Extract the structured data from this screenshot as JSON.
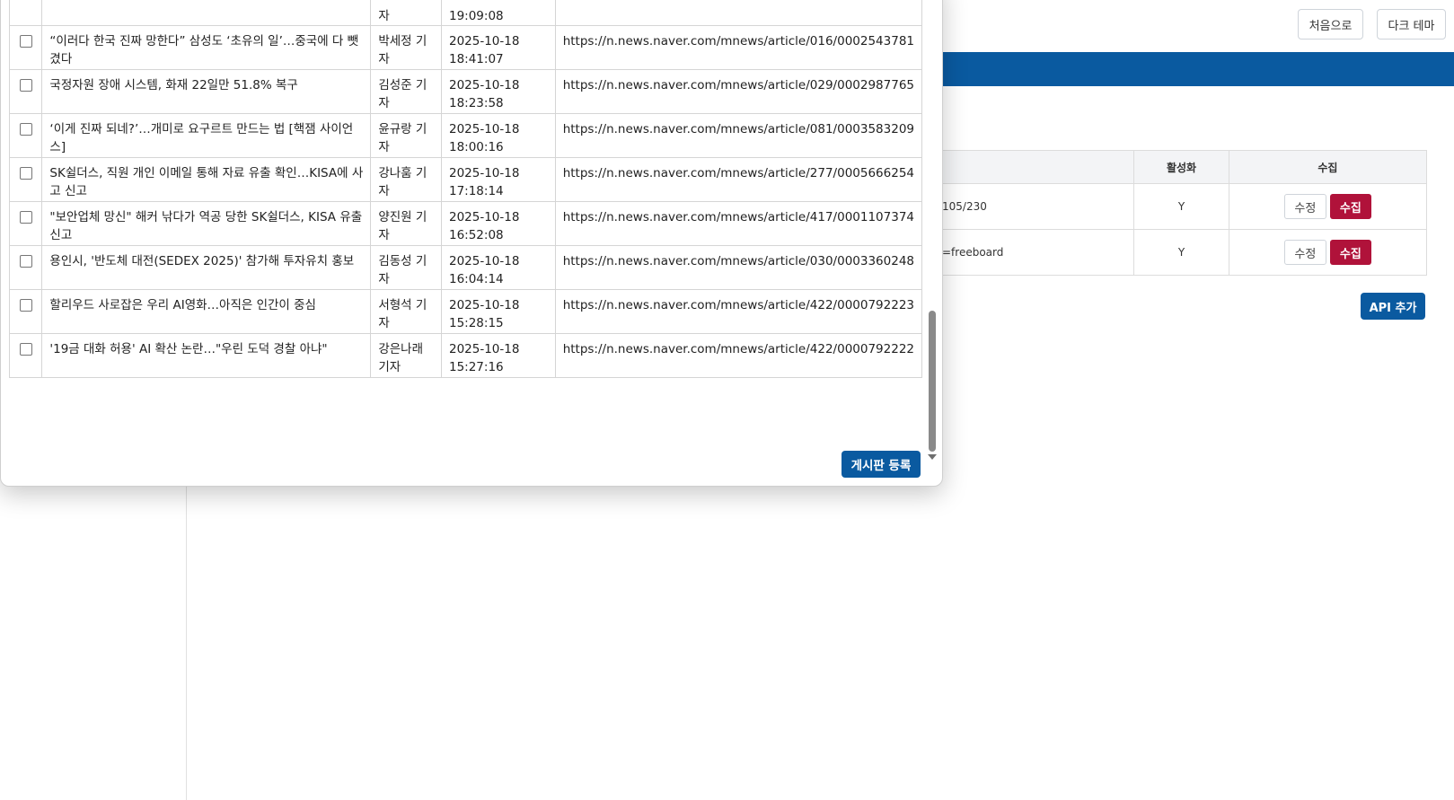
{
  "header": {
    "first_button": "처음으로",
    "dark_theme_button": "다크 테마"
  },
  "api_table": {
    "headers": [
      "활성화",
      "수집"
    ],
    "rows": [
      {
        "url_fragment": "105/230",
        "active": "Y",
        "edit": "수정",
        "collect": "수집"
      },
      {
        "url_fragment": "=freeboard",
        "active": "Y",
        "edit": "수정",
        "collect": "수집"
      }
    ],
    "add_button": "API 추가"
  },
  "modal": {
    "register_button": "게시판 등록",
    "top_partial": {
      "author": "자",
      "time": "19:09:08"
    },
    "rows": [
      {
        "title": "“이러다 한국 진짜 망한다” 삼성도 ‘초유의 일’…중국에 다 뺏겼다",
        "author": "박세정 기자",
        "date": "2025-10-18",
        "time": "18:41:07",
        "url": "https://n.news.naver.com/mnews/article/016/0002543781"
      },
      {
        "title": "국정자원 장애 시스템, 화재 22일만 51.8% 복구",
        "author": "김성준 기자",
        "date": "2025-10-18",
        "time": "18:23:58",
        "url": "https://n.news.naver.com/mnews/article/029/0002987765"
      },
      {
        "title": "‘이게 진짜 되네?’…개미로 요구르트 만드는 법 [핵잼 사이언스]",
        "author": "윤규랑 기자",
        "date": "2025-10-18",
        "time": "18:00:16",
        "url": "https://n.news.naver.com/mnews/article/081/0003583209"
      },
      {
        "title": "SK쉴더스, 직원 개인 이메일 통해 자료 유출 확인…KISA에 사고 신고",
        "author": "강나훔 기자",
        "date": "2025-10-18",
        "time": "17:18:14",
        "url": "https://n.news.naver.com/mnews/article/277/0005666254"
      },
      {
        "title": "\"보안업체 망신\" 해커 낚다가 역공 당한 SK쉴더스, KISA 유출 신고",
        "author": "양진원 기자",
        "date": "2025-10-18",
        "time": "16:52:08",
        "url": "https://n.news.naver.com/mnews/article/417/0001107374"
      },
      {
        "title": "용인시, '반도체 대전(SEDEX 2025)' 참가해 투자유치 홍보",
        "author": "김동성 기자",
        "date": "2025-10-18",
        "time": "16:04:14",
        "url": "https://n.news.naver.com/mnews/article/030/0003360248"
      },
      {
        "title": "할리우드 사로잡은 우리 AI영화…아직은 인간이 중심",
        "author": "서형석 기자",
        "date": "2025-10-18",
        "time": "15:28:15",
        "url": "https://n.news.naver.com/mnews/article/422/0000792223"
      },
      {
        "title": "'19금 대화 허용' AI 확산 논란…\"우린 도덕 경찰 아냐\"",
        "author": "강은나래 기자",
        "date": "2025-10-18",
        "time": "15:27:16",
        "url": "https://n.news.naver.com/mnews/article/422/0000792222"
      }
    ]
  }
}
